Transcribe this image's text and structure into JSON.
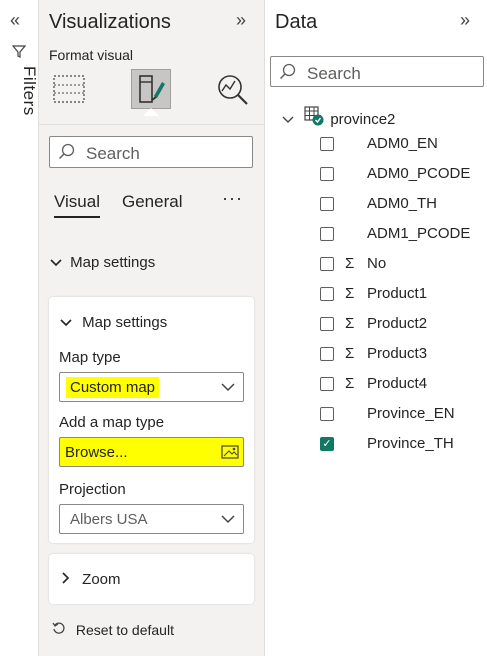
{
  "filters": {
    "label": "Filters",
    "chevron": "«",
    "icon": "filter-icon"
  },
  "visualizations": {
    "title": "Visualizations",
    "collapse": "»",
    "format_visual_label": "Format visual",
    "search_placeholder": "Search",
    "tabs": [
      {
        "label": "Visual",
        "active": true
      },
      {
        "label": "General",
        "active": false
      }
    ],
    "more": "···",
    "section_title": "Map settings",
    "card": {
      "title": "Map settings",
      "map_type_label": "Map type",
      "map_type_value": "Custom map",
      "add_map_type_label": "Add a map type",
      "browse_value": "Browse...",
      "projection_label": "Projection",
      "projection_value": "Albers USA"
    },
    "zoom_label": "Zoom",
    "reset_label": "Reset to default"
  },
  "data": {
    "title": "Data",
    "collapse": "»",
    "search_placeholder": "Search",
    "table_name": "province2",
    "fields": [
      {
        "name": "ADM0_EN",
        "sigma": "",
        "checked": false
      },
      {
        "name": "ADM0_PCODE",
        "sigma": "",
        "checked": false
      },
      {
        "name": "ADM0_TH",
        "sigma": "",
        "checked": false
      },
      {
        "name": "ADM1_PCODE",
        "sigma": "",
        "checked": false
      },
      {
        "name": "No",
        "sigma": "Σ",
        "checked": false
      },
      {
        "name": "Product1",
        "sigma": "Σ",
        "checked": false
      },
      {
        "name": "Product2",
        "sigma": "Σ",
        "checked": false
      },
      {
        "name": "Product3",
        "sigma": "Σ",
        "checked": false
      },
      {
        "name": "Product4",
        "sigma": "Σ",
        "checked": false
      },
      {
        "name": "Province_EN",
        "sigma": "",
        "checked": false
      },
      {
        "name": "Province_TH",
        "sigma": "",
        "checked": true
      }
    ]
  },
  "colors": {
    "highlight": "#ffff00",
    "check": "#117865",
    "pane_bg": "#f3f2f1"
  }
}
